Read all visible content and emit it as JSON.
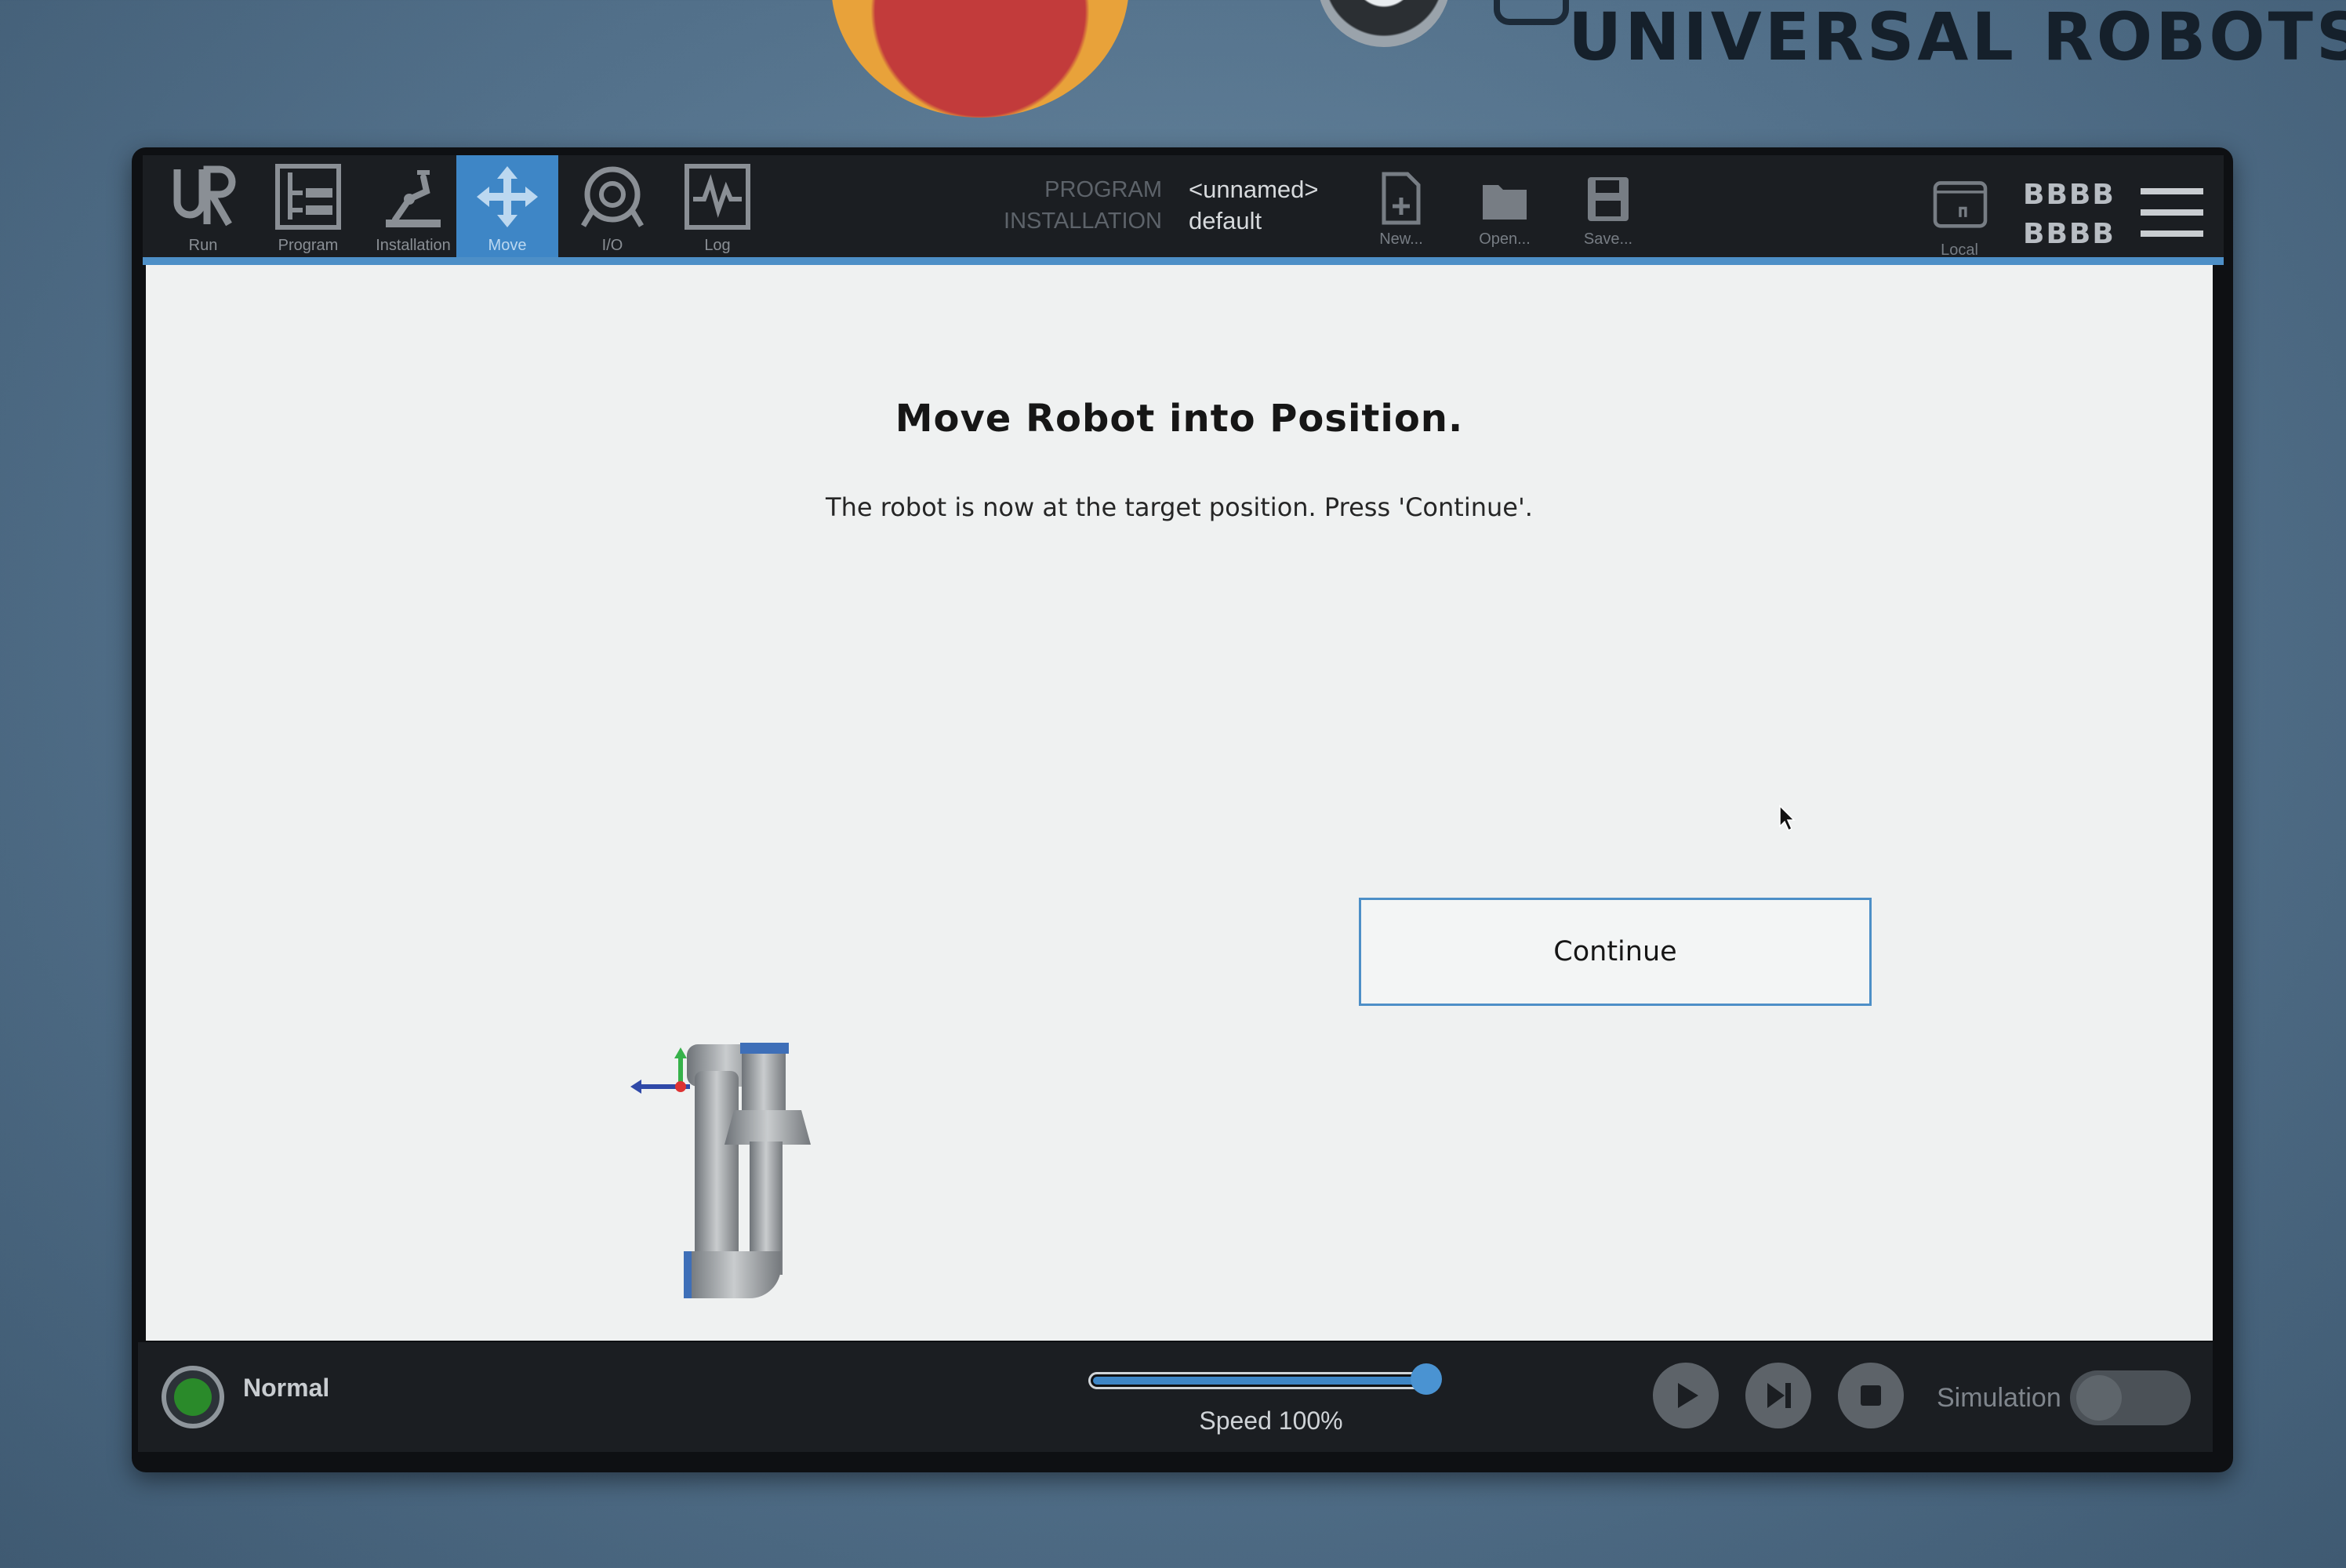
{
  "device": {
    "brand": "UNIVERSAL ROBOTS"
  },
  "topbar": {
    "tabs": [
      {
        "label": "Run",
        "icon": "ur-logo-icon"
      },
      {
        "label": "Program",
        "icon": "program-tree-icon"
      },
      {
        "label": "Installation",
        "icon": "robot-arm-icon"
      },
      {
        "label": "Move",
        "icon": "move-arrows-icon",
        "active": true
      },
      {
        "label": "I/O",
        "icon": "io-icon"
      },
      {
        "label": "Log",
        "icon": "log-graph-icon"
      }
    ],
    "program_label": "PROGRAM",
    "program_value": "<unnamed>",
    "installation_label": "INSTALLATION",
    "installation_value": "default",
    "file_buttons": [
      {
        "label": "New...",
        "icon": "new-file-icon"
      },
      {
        "label": "Open...",
        "icon": "folder-icon"
      },
      {
        "label": "Save...",
        "icon": "save-icon"
      }
    ],
    "local_label": "Local",
    "id_line1": "BBBB",
    "id_line2": "BBBB",
    "accent_color": "#3e86c6"
  },
  "content": {
    "title": "Move Robot into Position.",
    "message": "The robot is now at the target position. Press 'Continue'.",
    "continue_label": "Continue"
  },
  "bottombar": {
    "status": "Normal",
    "status_color": "#2a8a2a",
    "speed_label": "Speed 100%",
    "speed_fraction": 1.0,
    "simulation_label": "Simulation",
    "simulation_on": false
  }
}
